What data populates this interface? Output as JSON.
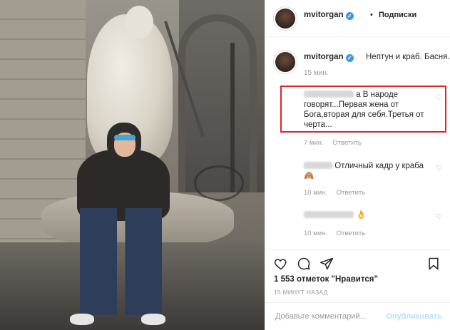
{
  "header": {
    "username": "mvitorgan",
    "separator": "•",
    "follow_label": "Подписки"
  },
  "caption": {
    "username": "mvitorgan",
    "text": "Нептун и краб. Басня.",
    "time": "15 мин."
  },
  "comments": [
    {
      "user": "w.........",
      "text_line1": "а В народе",
      "text_rest": "говорят...Первая жена от Бога,вторая для себя.Третья от черта...",
      "time": "7 мин.",
      "reply_label": "Ответить"
    },
    {
      "user": "l........",
      "text": "Отличный кадр у краба🙈",
      "time": "10 мин.",
      "reply_label": "Ответить"
    },
    {
      "user": "elia.........el",
      "text": "👌",
      "time": "10 мин.",
      "reply_label": "Ответить"
    }
  ],
  "icons": {
    "like": "heart-outline",
    "comment": "speech-bubble",
    "share": "paper-plane",
    "save": "bookmark"
  },
  "likes_text": "1 553 отметок \"Нравится\"",
  "posted_text": "15 МИНУТ НАЗАД",
  "add_comment_placeholder": "Добавьте комментарий...",
  "publish_label": "Опубликовать",
  "colors": {
    "verified": "#3897f0",
    "highlight": "#e0262b",
    "publish_disabled": "#b2dffc"
  }
}
